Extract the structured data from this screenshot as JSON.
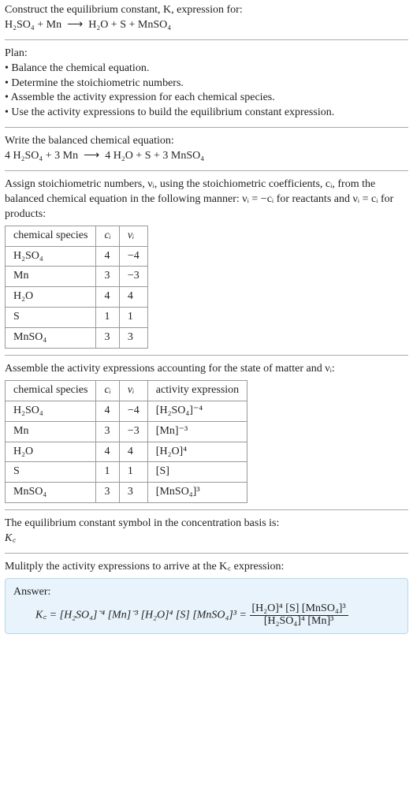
{
  "intro": {
    "line1": "Construct the equilibrium constant, K, expression for:",
    "equation_lhs": "H₂SO₄ + Mn",
    "arrow": "⟶",
    "equation_rhs": "H₂O + S + MnSO₄"
  },
  "plan": {
    "heading": "Plan:",
    "items": [
      "Balance the chemical equation.",
      "Determine the stoichiometric numbers.",
      "Assemble the activity expression for each chemical species.",
      "Use the activity expressions to build the equilibrium constant expression."
    ]
  },
  "balanced": {
    "heading": "Write the balanced chemical equation:",
    "lhs": "4 H₂SO₄ + 3 Mn",
    "arrow": "⟶",
    "rhs": "4 H₂O + S + 3 MnSO₄"
  },
  "stoich_intro": {
    "part1": "Assign stoichiometric numbers, νᵢ, using the stoichiometric coefficients, cᵢ, from the balanced chemical equation in the following manner: νᵢ = −cᵢ for reactants and νᵢ = cᵢ for products:"
  },
  "table1": {
    "headers": {
      "species": "chemical species",
      "c": "cᵢ",
      "v": "νᵢ"
    },
    "rows": [
      {
        "species": "H₂SO₄",
        "c": "4",
        "v": "−4"
      },
      {
        "species": "Mn",
        "c": "3",
        "v": "−3"
      },
      {
        "species": "H₂O",
        "c": "4",
        "v": "4"
      },
      {
        "species": "S",
        "c": "1",
        "v": "1"
      },
      {
        "species": "MnSO₄",
        "c": "3",
        "v": "3"
      }
    ]
  },
  "activity_intro": "Assemble the activity expressions accounting for the state of matter and νᵢ:",
  "table2": {
    "headers": {
      "species": "chemical species",
      "c": "cᵢ",
      "v": "νᵢ",
      "act": "activity expression"
    },
    "rows": [
      {
        "species": "H₂SO₄",
        "c": "4",
        "v": "−4",
        "act": "[H₂SO₄]⁻⁴"
      },
      {
        "species": "Mn",
        "c": "3",
        "v": "−3",
        "act": "[Mn]⁻³"
      },
      {
        "species": "H₂O",
        "c": "4",
        "v": "4",
        "act": "[H₂O]⁴"
      },
      {
        "species": "S",
        "c": "1",
        "v": "1",
        "act": "[S]"
      },
      {
        "species": "MnSO₄",
        "c": "3",
        "v": "3",
        "act": "[MnSO₄]³"
      }
    ]
  },
  "basis": {
    "line1": "The equilibrium constant symbol in the concentration basis is:",
    "symbol": "K꜀"
  },
  "multiply_intro": "Mulitply the activity expressions to arrive at the K꜀ expression:",
  "answer": {
    "label": "Answer:",
    "lhs": "K꜀ = [H₂SO₄]⁻⁴ [Mn]⁻³ [H₂O]⁴ [S] [MnSO₄]³ = ",
    "num": "[H₂O]⁴ [S] [MnSO₄]³",
    "den": "[H₂SO₄]⁴ [Mn]³"
  },
  "bullet": "•"
}
